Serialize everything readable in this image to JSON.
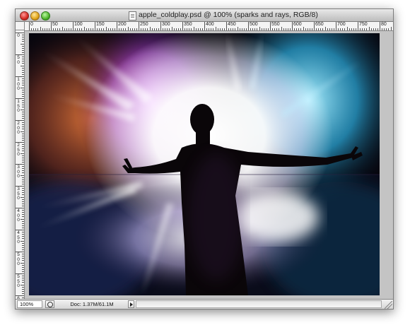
{
  "window": {
    "title": "apple_coldplay.psd @ 100% (sparks and rays, RGB/8)"
  },
  "ruler_h_labels": [
    "0",
    "50",
    "100",
    "150",
    "200",
    "250",
    "300",
    "350",
    "400",
    "450",
    "500",
    "550",
    "600",
    "650",
    "700",
    "750",
    "80"
  ],
  "ruler_v_labels": [
    "0",
    "50",
    "100",
    "150",
    "200",
    "250",
    "300",
    "350",
    "400",
    "450",
    "500",
    "550",
    "600"
  ],
  "image": {
    "description_icon": "silhouette-photo"
  },
  "status": {
    "zoom": "100%",
    "doc_info": "Doc: 1.37M/61.1M"
  },
  "colors": {
    "left_glow": "#d0602a",
    "magenta_glow": "#c060e0",
    "cyan_glow": "#3ec8f0",
    "core": "#ffffff"
  }
}
